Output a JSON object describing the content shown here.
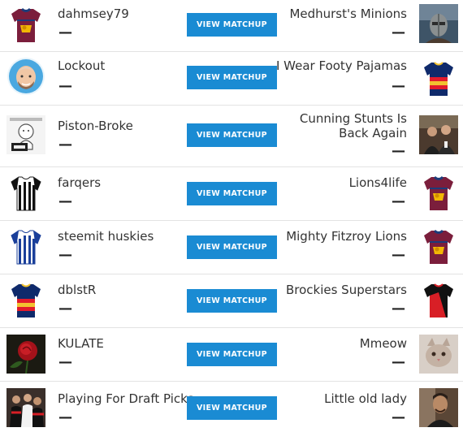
{
  "matchups": [
    {
      "home": {
        "name": "dahmsey79",
        "score": "—",
        "avatar": "guernsey-lions-icon"
      },
      "away": {
        "name": "Medhurst's Minions",
        "score": "—",
        "avatar": "gladiator-photo-icon"
      },
      "button": "VIEW MATCHUP"
    },
    {
      "home": {
        "name": "Lockout",
        "score": "—",
        "avatar": "cartoon-man-avatar-icon"
      },
      "away": {
        "name": "I Wear Footy Pajamas",
        "score": "—",
        "avatar": "guernsey-adelaide-icon"
      },
      "button": "VIEW MATCHUP"
    },
    {
      "home": {
        "name": "Piston-Broke",
        "score": "—",
        "avatar": "meme-baby-icon"
      },
      "away": {
        "name": "Cunning Stunts Is Back Again",
        "score": "—",
        "avatar": "two-men-photo-icon"
      },
      "button": "VIEW MATCHUP"
    },
    {
      "home": {
        "name": "farqers",
        "score": "—",
        "avatar": "guernsey-collingwood-icon"
      },
      "away": {
        "name": "Lions4life",
        "score": "—",
        "avatar": "guernsey-lions-icon"
      },
      "button": "VIEW MATCHUP"
    },
    {
      "home": {
        "name": "steemit huskies",
        "score": "—",
        "avatar": "guernsey-north-melbourne-icon"
      },
      "away": {
        "name": "Mighty Fitzroy Lions",
        "score": "—",
        "avatar": "guernsey-lions-icon"
      },
      "button": "VIEW MATCHUP"
    },
    {
      "home": {
        "name": "dblstR",
        "score": "—",
        "avatar": "guernsey-adelaide-icon"
      },
      "away": {
        "name": "Brockies Superstars",
        "score": "—",
        "avatar": "guernsey-essendon-icon"
      },
      "button": "VIEW MATCHUP"
    },
    {
      "home": {
        "name": "KULATE",
        "score": "—",
        "avatar": "red-rose-photo-icon"
      },
      "away": {
        "name": "Mmeow",
        "score": "—",
        "avatar": "kitten-photo-icon"
      },
      "button": "VIEW MATCHUP"
    },
    {
      "home": {
        "name": "Playing For Draft Picks",
        "score": "—",
        "avatar": "players-photo-icon"
      },
      "away": {
        "name": "Little old lady",
        "score": "—",
        "avatar": "man-photo-icon"
      },
      "button": "VIEW MATCHUP"
    }
  ],
  "colors": {
    "button": "#1a8bd3",
    "divider": "#e3e3e3",
    "text": "#333333"
  }
}
